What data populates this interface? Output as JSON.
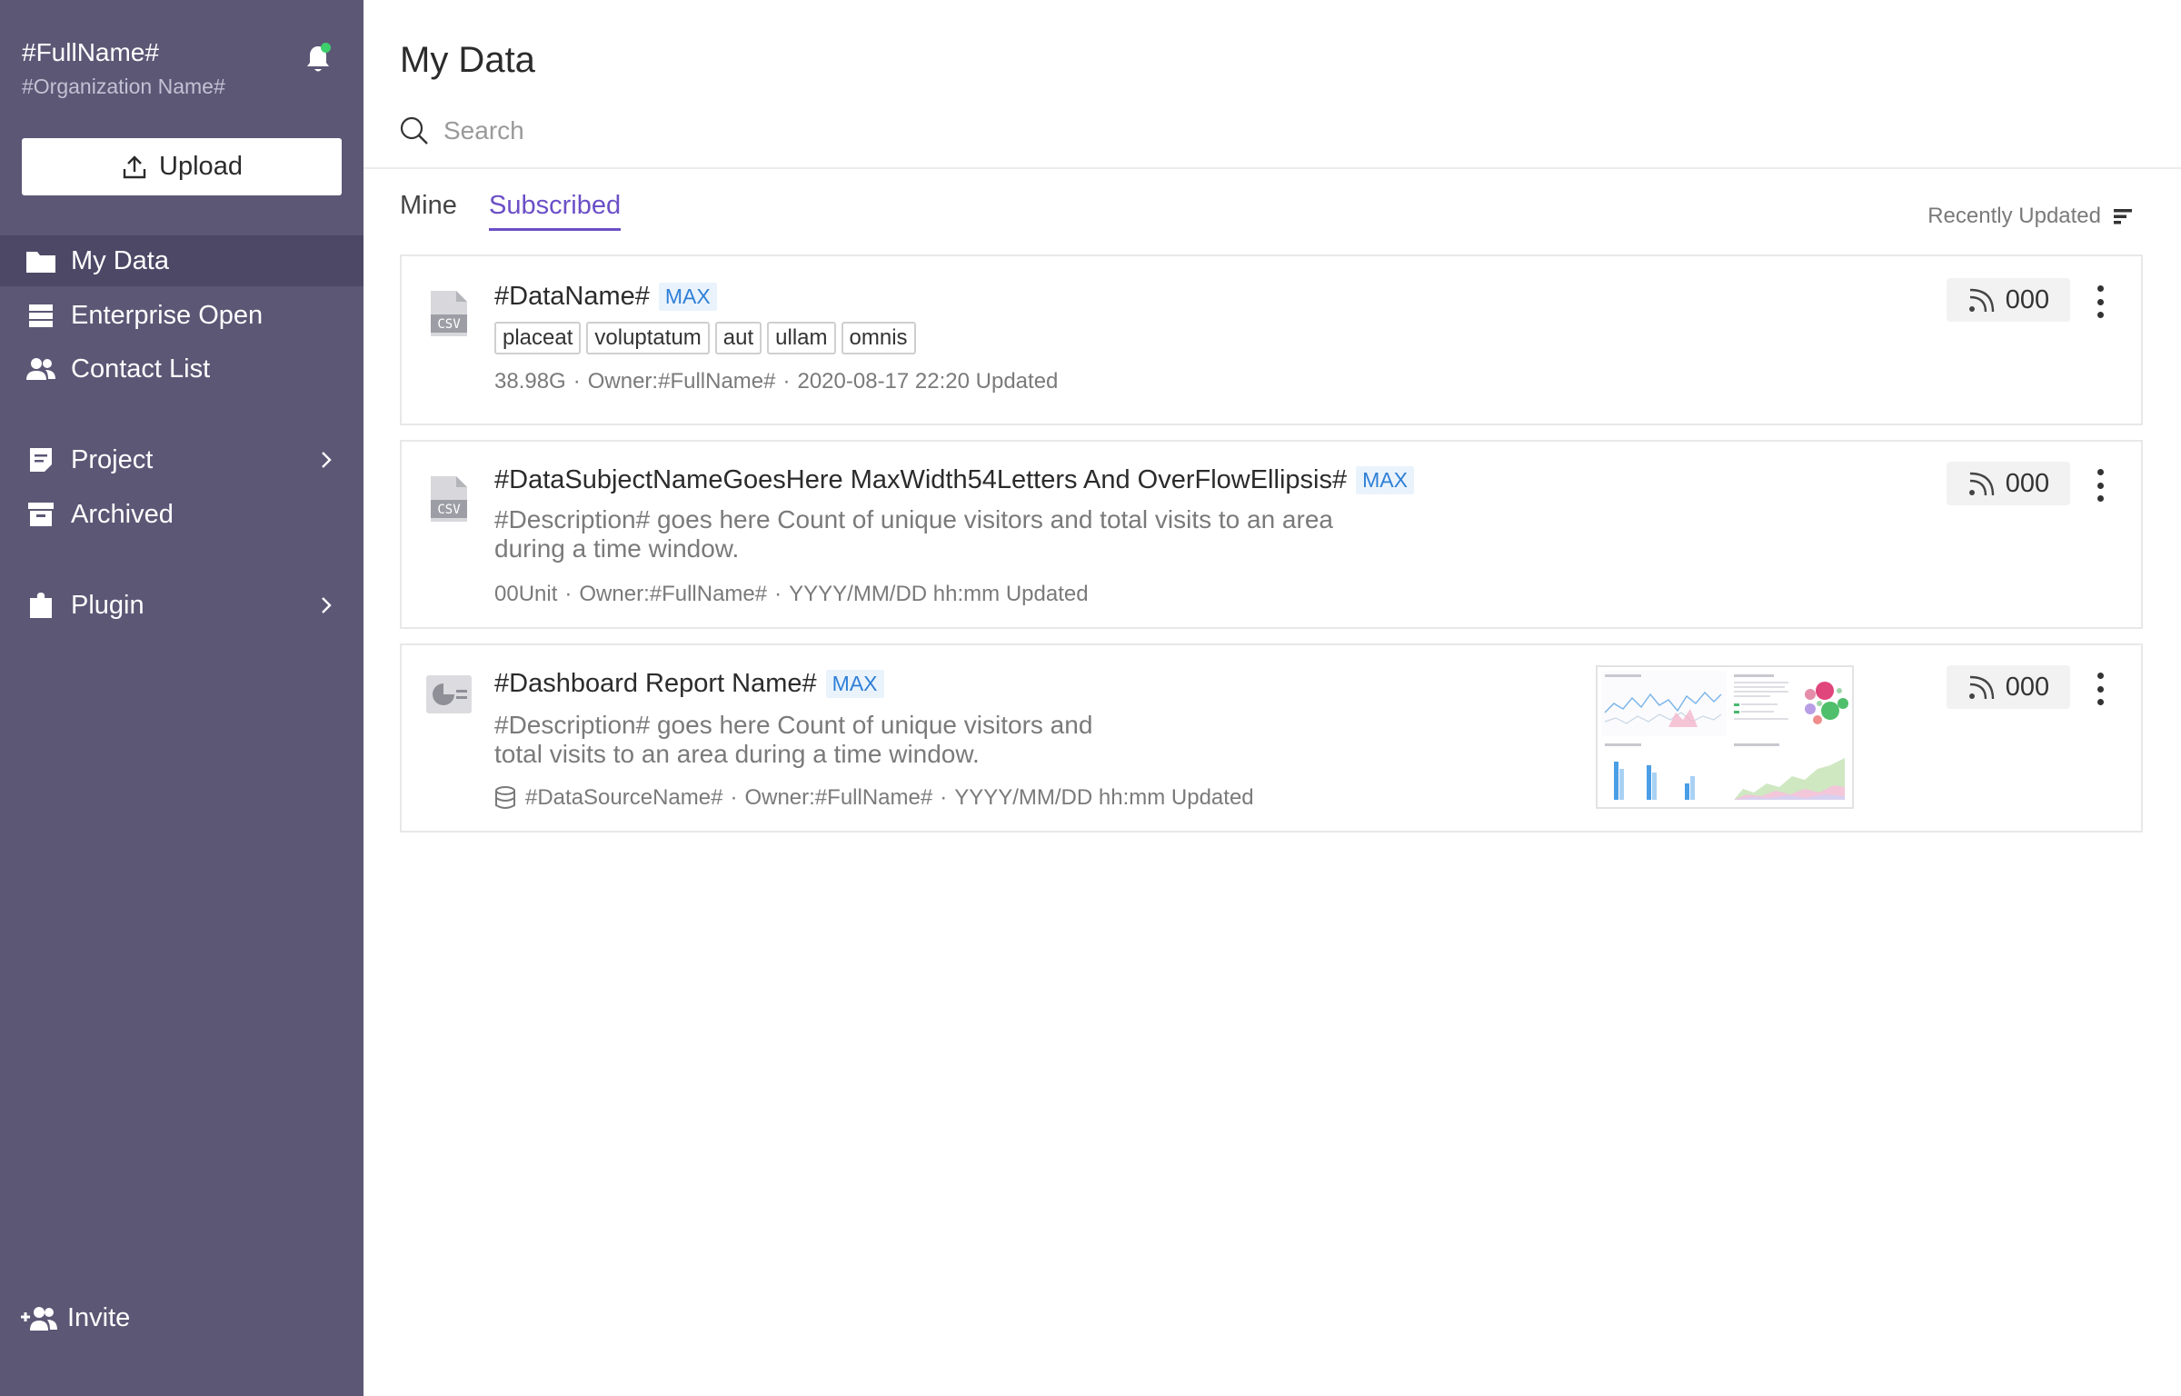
{
  "sidebar": {
    "user_name": "#FullName#",
    "org_name": "#Organization Name#",
    "upload_label": "Upload",
    "nav": [
      {
        "label": "My Data",
        "icon": "folder-icon"
      },
      {
        "label": "Enterprise Open",
        "icon": "database-stack-icon"
      },
      {
        "label": "Contact List",
        "icon": "people-icon"
      },
      {
        "label": "Project",
        "icon": "document-icon"
      },
      {
        "label": "Archived",
        "icon": "archive-box-icon"
      },
      {
        "label": "Plugin",
        "icon": "puzzle-icon"
      }
    ],
    "invite_label": "Invite",
    "notification_dot_color": "#3ccf6b"
  },
  "main": {
    "title": "My Data",
    "search_placeholder": "Search",
    "tabs": [
      {
        "label": "Mine",
        "active": false
      },
      {
        "label": "Subscribed",
        "active": true
      }
    ],
    "sort_label": "Recently Updated",
    "accent_color": "#6b4fc7",
    "items": [
      {
        "icon": "csv-file-icon",
        "title": "#DataName#",
        "badge": "MAX",
        "tags": [
          "placeat",
          "voluptatum",
          "aut",
          "ullam",
          "omnis"
        ],
        "size": "38.98G",
        "owner": "Owner:#FullName#",
        "updated": "2020-08-17 22:20 Updated",
        "subscribers": "000"
      },
      {
        "icon": "csv-file-icon",
        "title": "#DataSubjectNameGoesHere MaxWidth54Letters And OverFlowEllipsis#",
        "badge": "MAX",
        "description_line1": "#Description# goes here Count of unique visitors and total visits to an area",
        "description_line2": "during a time window.",
        "size": "00Unit",
        "owner": "Owner:#FullName#",
        "updated": "YYYY/MM/DD hh:mm Updated",
        "subscribers": "000"
      },
      {
        "icon": "dashboard-icon",
        "title": "#Dashboard Report Name#",
        "badge": "MAX",
        "description_line1": "#Description# goes here Count of unique visitors and",
        "description_line2": "total visits to an area during a time window.",
        "datasource": "#DataSourceName#",
        "owner": "Owner:#FullName#",
        "updated": "YYYY/MM/DD hh:mm Updated",
        "subscribers": "000"
      }
    ]
  }
}
